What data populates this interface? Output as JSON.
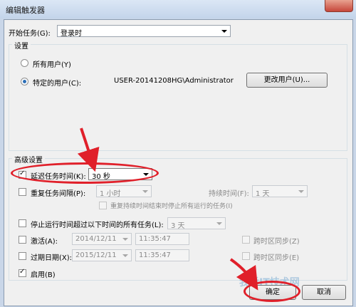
{
  "window": {
    "title": "编辑触发器"
  },
  "start_task": {
    "label": "开始任务(G):",
    "value": "登录时"
  },
  "settings": {
    "group_label": "设置",
    "all_users_label": "所有用户(Y)",
    "specific_user_label": "特定的用户(C):",
    "user_name": "USER-20141208HG\\Administrator",
    "change_user_button": "更改用户(U)..."
  },
  "advanced": {
    "group_label": "高级设置",
    "delay_label": "延迟任务时间(K):",
    "delay_value": "30 秒",
    "repeat_label": "重复任务间隔(P):",
    "repeat_value": "1 小时",
    "duration_label": "持续时间(F):",
    "duration_value": "1 天",
    "stop_repeat_label": "重复持续时间结束时停止所有运行的任务(I)",
    "stop_long_label": "停止运行时间超过以下时间的所有任务(L):",
    "stop_long_value": "3 天",
    "activate_label": "激活(A):",
    "activate_date": "2014/12/11",
    "activate_time": "11:35:47",
    "activate_sync_label": "跨时区同步(Z)",
    "expire_label": "过期日期(X):",
    "expire_date": "2015/12/11",
    "expire_time": "11:35:47",
    "expire_sync_label": "跨时区同步(E)",
    "enabled_label": "启用(B)"
  },
  "buttons": {
    "ok": "确定",
    "cancel": "取消"
  },
  "watermark": {
    "text": "我爱IT技术网"
  },
  "annotation_color": "#e0202a"
}
